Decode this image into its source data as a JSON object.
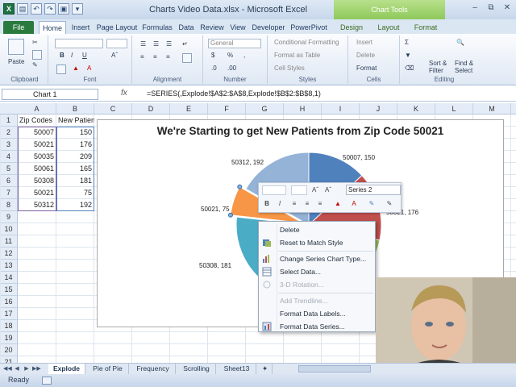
{
  "window": {
    "title": "Charts Video Data.xlsx - Microsoft Excel",
    "chart_tools_label": "Chart Tools"
  },
  "ribbon_tabs": [
    "File",
    "Home",
    "Insert",
    "Page Layout",
    "Formulas",
    "Data",
    "Review",
    "View",
    "Developer",
    "PowerPivot",
    "Design",
    "Layout",
    "Format"
  ],
  "ribbon": {
    "clipboard": {
      "label": "Clipboard",
      "paste": "Paste"
    },
    "font": {
      "label": "Font"
    },
    "alignment": {
      "label": "Alignment"
    },
    "number": {
      "label": "Number",
      "format": "General"
    },
    "styles": {
      "label": "Styles",
      "conditional": "Conditional Formatting",
      "format_table": "Format as Table",
      "cell_styles": "Cell Styles"
    },
    "cells": {
      "label": "Cells",
      "insert": "Insert",
      "delete": "Delete",
      "format": "Format"
    },
    "editing": {
      "label": "Editing",
      "sort": "Sort & Filter",
      "find": "Find & Select"
    }
  },
  "formula_bar": {
    "name_box": "Chart 1",
    "fx": "fx",
    "formula": "=SERIES(,Explode!$A$2:$A$8,Explode!$B$2:$B$8,1)"
  },
  "columns": [
    "A",
    "B",
    "C",
    "D",
    "E",
    "F",
    "G",
    "H",
    "I",
    "J",
    "K",
    "L",
    "M"
  ],
  "rows": [
    "1",
    "2",
    "3",
    "4",
    "5",
    "6",
    "7",
    "8",
    "9",
    "10",
    "11",
    "12",
    "13",
    "14",
    "15",
    "16",
    "17",
    "18",
    "19",
    "20",
    "21"
  ],
  "table": {
    "headers": [
      "Zip Codes",
      "New Patients"
    ],
    "data": [
      [
        "50007",
        "150"
      ],
      [
        "50021",
        "176"
      ],
      [
        "50035",
        "209"
      ],
      [
        "50061",
        "165"
      ],
      [
        "50308",
        "181"
      ],
      [
        "50021",
        "75"
      ],
      [
        "50312",
        "192"
      ]
    ]
  },
  "chart_data": {
    "type": "pie",
    "title": "We're Starting to get New Patients from Zip Code 50021",
    "categories": [
      "50007",
      "50021",
      "50035",
      "50061",
      "50308",
      "50021",
      "50312"
    ],
    "values": [
      150,
      176,
      209,
      165,
      181,
      75,
      192
    ],
    "visible_data_labels": [
      "50007, 150",
      "50021, 176",
      "50308, 181",
      "50021, 75",
      "50312, 192"
    ],
    "colors": [
      "#4f81bd",
      "#c0504d",
      "#9bbb59",
      "#8064a2",
      "#4bacc6",
      "#f79646",
      "#95b3d7"
    ],
    "legend": "none",
    "highlighted_slice": "50021, 75"
  },
  "mini_toolbar": {
    "series_select": "Series 2",
    "buttons": [
      "B",
      "I"
    ]
  },
  "context_menu": {
    "items": [
      {
        "label": "Delete",
        "enabled": true
      },
      {
        "label": "Reset to Match Style",
        "enabled": true
      },
      {
        "label": "Change Series Chart Type...",
        "enabled": true
      },
      {
        "label": "Select Data...",
        "enabled": true
      },
      {
        "label": "3-D Rotation...",
        "enabled": false
      },
      {
        "label": "Add Trendline...",
        "enabled": false
      },
      {
        "label": "Format Data Labels...",
        "enabled": true
      },
      {
        "label": "Format Data Series...",
        "enabled": true
      }
    ]
  },
  "sheet_tabs": [
    "Explode",
    "Pie of Pie",
    "Frequency",
    "Scrolling",
    "Sheet13"
  ],
  "active_sheet": "Explode",
  "status": {
    "mode": "Ready"
  }
}
